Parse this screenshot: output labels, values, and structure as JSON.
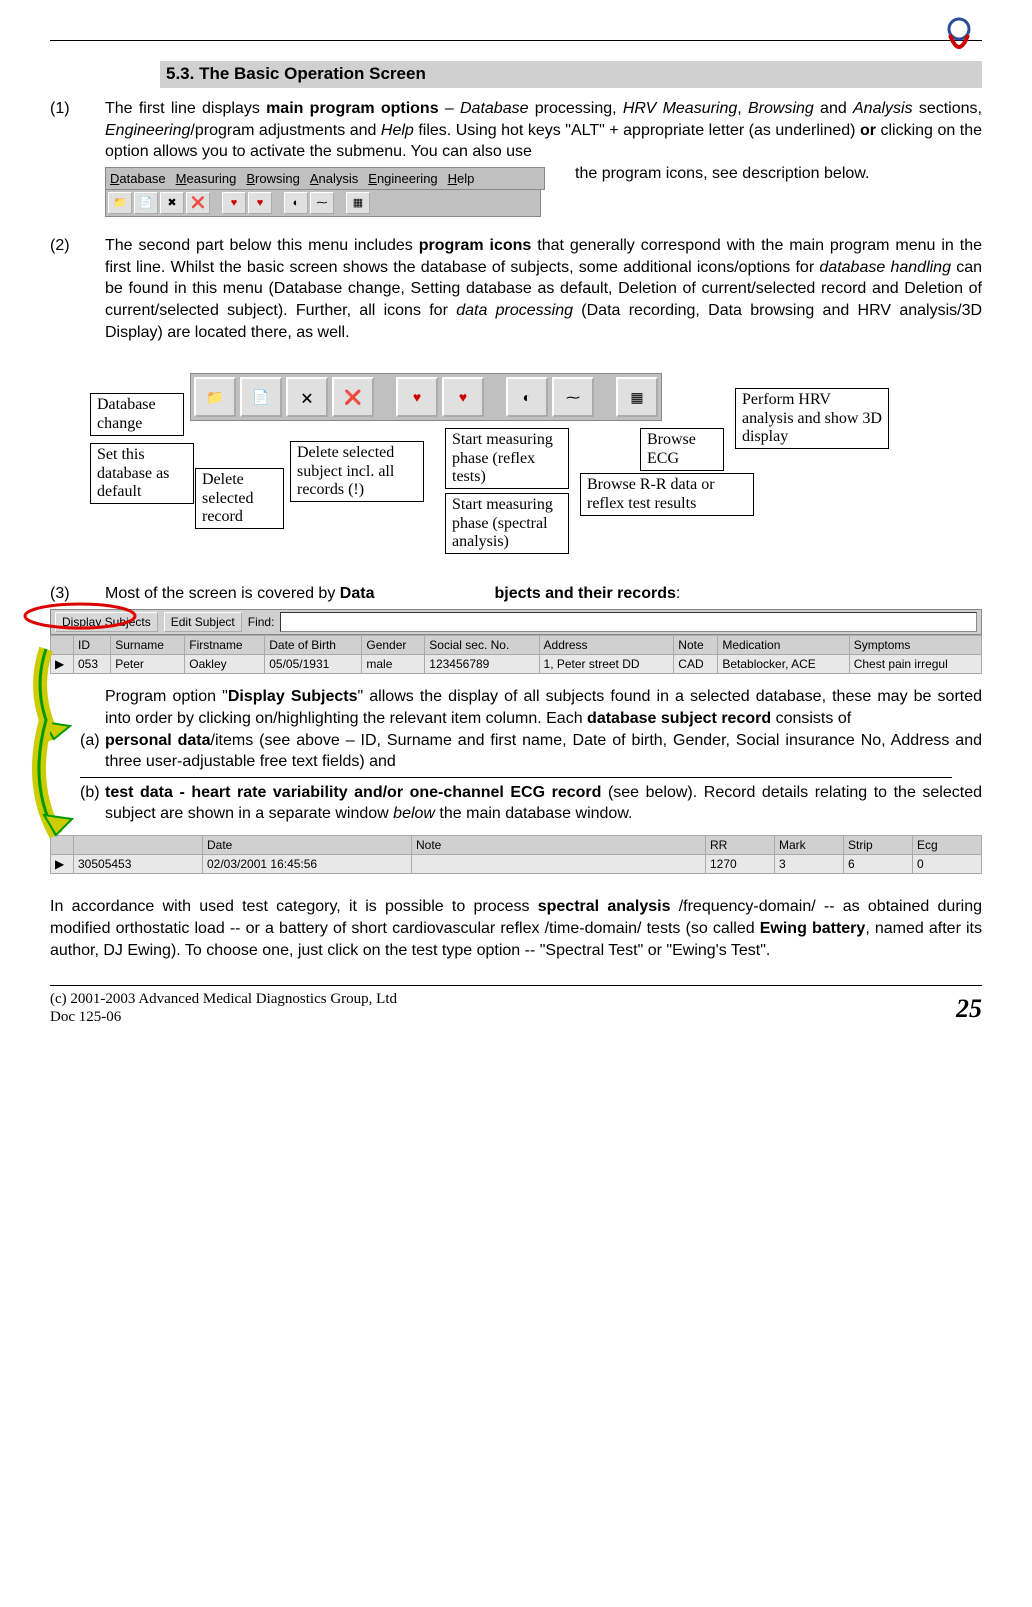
{
  "section_header": "5.3. The Basic Operation Screen",
  "para1": {
    "num": "(1)",
    "t1": "The first line displays ",
    "b1": "main program options",
    "t2": " – ",
    "i1": "Database",
    "t3": " processing, ",
    "i2": "HRV Measuring",
    "t4": ", ",
    "i3": "Browsing",
    "t5": " and ",
    "i4": "Analysis",
    "t6": " sections, ",
    "i5": "Engineering",
    "t7": "/program adjustments and ",
    "i6": "Help",
    "t8": " files. Using hot keys \"ALT\" + appropriate letter (as underlined) ",
    "b2": "or",
    "t9": " clicking on the option allows you to activate the submenu. You can also use ",
    "tail": "the program icons, see description below."
  },
  "menubar": {
    "items": [
      "Database",
      "Measuring",
      "Browsing",
      "Analysis",
      "Engineering",
      "Help"
    ]
  },
  "para2": {
    "num": "(2)",
    "t1": "The second part below this menu includes ",
    "b1": "program icons",
    "t2": " that generally correspond with the main program menu in the first line. Whilst the basic screen shows the database of subjects, some additional icons/options for ",
    "i1": "database handling",
    "t3": " can be found in this menu (Database change, Setting database as default, Deletion of current/selected record and Deletion of current/selected subject). Further, all icons for ",
    "i2": "data processing",
    "t4": " (Data recor­ding, Data browsing and HRV analysis/3D Display) are located there, as well."
  },
  "callouts": {
    "c1": "Database change",
    "c2": "Set this database as default",
    "c3": "Delete selected record",
    "c4": "Delete selected subject incl. all records (!)",
    "c5": "Start mea­suring phase (reflex tests)",
    "c6": "Start mea­suring pha­se (spectral analysis)",
    "c7": "Browse R-R data  or reflex test results",
    "c8": "Browse ECG",
    "c9": "Perform HRV analysis and show 3D display"
  },
  "para3": {
    "num": "(3)",
    "t1": "Most of the screen is covered by ",
    "b1": "Data",
    "b2": "bjects and their records",
    "t2": ":"
  },
  "findbar": {
    "btn1": "Display Subjects",
    "btn2": "Edit Subject",
    "find_label": "Find:"
  },
  "subjects_table": {
    "headers": [
      "",
      "ID",
      "Surname",
      "Firstname",
      "Date of Birth",
      "Gender",
      "Social sec. No.",
      "Address",
      "Note",
      "Medication",
      "Symptoms"
    ],
    "row": [
      "▶",
      "053",
      "Peter",
      "Oakley",
      "05/05/1931",
      "male",
      "123456789",
      "1, Peter street DD",
      "CAD",
      "Betablocker, ACE",
      "Chest pain irregul"
    ]
  },
  "para_prog": {
    "t1": "Program option \"",
    "b1": "Display Subjects",
    "t2": "\" allows the display of all subjects found in a selected database, these may be sorted into order by clicking on/highlighting the relevant item column. Each ",
    "b2": "database subject record",
    "t3": " consists of"
  },
  "item_a": {
    "lbl": "(a)",
    "b1": "personal data",
    "t1": "/items (see above – ID, Surname and first name, Date of birth, Gender, Social insurance No, Address and three user-adjustable free text fields) and"
  },
  "item_b": {
    "lbl": "(b)",
    "b1": "test data - heart rate variability and/or one-channel ECG record",
    "t1": " (see below). Record details relating to the selected subject are shown in a separate window ",
    "i1": "below",
    "t2": " the main database window."
  },
  "records_table": {
    "headers": [
      "",
      "",
      "Date",
      "Note",
      "RR",
      "Mark",
      "Strip",
      "Ecg"
    ],
    "row": [
      "▶",
      "30505453",
      "02/03/2001 16:45:56",
      "",
      "1270",
      "3",
      "6",
      "0"
    ]
  },
  "para_final": {
    "t1": "In accordance with used test category, it is possible to process ",
    "b1": "spectral analysis",
    "t2": " /frequency-domain/ -- as obtained during modified orthostatic load -- or a battery of short cardiovascular reflex /time-domain/ tests (so called ",
    "b2": "Ewing battery",
    "t3": ", named after its author, DJ Ewing). To choose one, just click on the test type option -- \"Spectral Test\" or \"Ewing's Test\"."
  },
  "footer": {
    "copyright": "(c) 2001-2003 Advanced Medical Diagnostics Group, Ltd",
    "docid": "Doc 125-06",
    "page": "25"
  }
}
